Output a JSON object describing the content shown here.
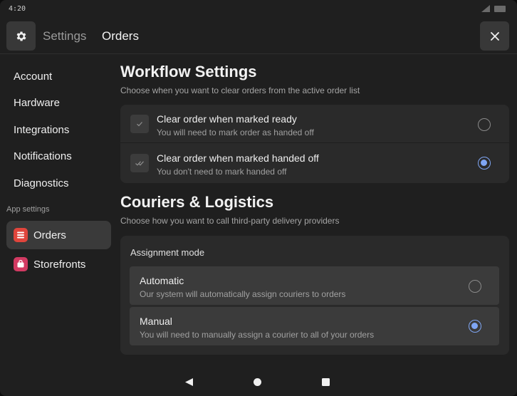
{
  "status_bar": {
    "time": "4:20"
  },
  "header": {
    "title": "Settings",
    "subtitle": "Orders"
  },
  "sidebar": {
    "items": [
      {
        "label": "Account"
      },
      {
        "label": "Hardware"
      },
      {
        "label": "Integrations"
      },
      {
        "label": "Notifications"
      },
      {
        "label": "Diagnostics"
      }
    ],
    "section_label": "App settings",
    "apps": [
      {
        "label": "Orders",
        "color": "#e0453c",
        "selected": true
      },
      {
        "label": "Storefronts",
        "color": "#d23a62",
        "selected": false
      }
    ]
  },
  "workflow": {
    "title": "Workflow Settings",
    "description": "Choose when you want to clear orders from the active order list",
    "options": [
      {
        "title": "Clear order when marked ready",
        "description": "You will need to mark order as handed off",
        "icon": "check-icon",
        "selected": false
      },
      {
        "title": "Clear order when marked handed off",
        "description": "You don't need to mark handed off",
        "icon": "double-check-icon",
        "selected": true
      }
    ]
  },
  "couriers": {
    "title": "Couriers & Logistics",
    "description": "Choose how you want to call third-party delivery providers",
    "assignment_label": "Assignment mode",
    "options": [
      {
        "title": "Automatic",
        "description": "Our system will automatically assign couriers to orders",
        "selected": false
      },
      {
        "title": "Manual",
        "description": "You will need to manually assign a courier to all of your orders",
        "selected": true
      }
    ]
  },
  "colors": {
    "accent": "#7fa6f4",
    "background": "#1f1f1f",
    "card": "#2a2a2a"
  }
}
